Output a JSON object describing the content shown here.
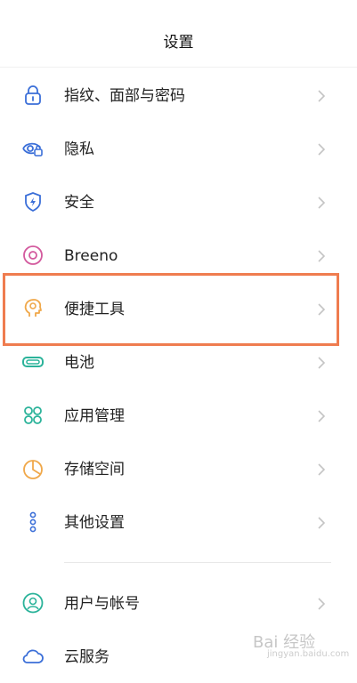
{
  "header": {
    "title": "设置"
  },
  "items": [
    {
      "label": "指纹、面部与密码",
      "icon": "lock-icon"
    },
    {
      "label": "隐私",
      "icon": "eye-lock-icon"
    },
    {
      "label": "安全",
      "icon": "shield-icon"
    },
    {
      "label": "Breeno",
      "icon": "breeno-icon"
    },
    {
      "label": "便捷工具",
      "icon": "head-tool-icon"
    },
    {
      "label": "电池",
      "icon": "battery-icon"
    },
    {
      "label": "应用管理",
      "icon": "apps-grid-icon"
    },
    {
      "label": "存储空间",
      "icon": "pie-chart-icon"
    },
    {
      "label": "其他设置",
      "icon": "more-dots-icon"
    },
    {
      "label": "用户与帐号",
      "icon": "user-icon"
    },
    {
      "label": "云服务",
      "icon": "cloud-icon"
    }
  ],
  "colors": {
    "icon_blue": "#3b6fd8",
    "icon_pink": "#d35a9e",
    "icon_orange": "#f0a84a",
    "icon_green": "#2bb39a",
    "highlight": "#ef7c4f"
  },
  "watermark": {
    "brand": "Bai 经验",
    "site": "jingyan.baidu.com"
  }
}
